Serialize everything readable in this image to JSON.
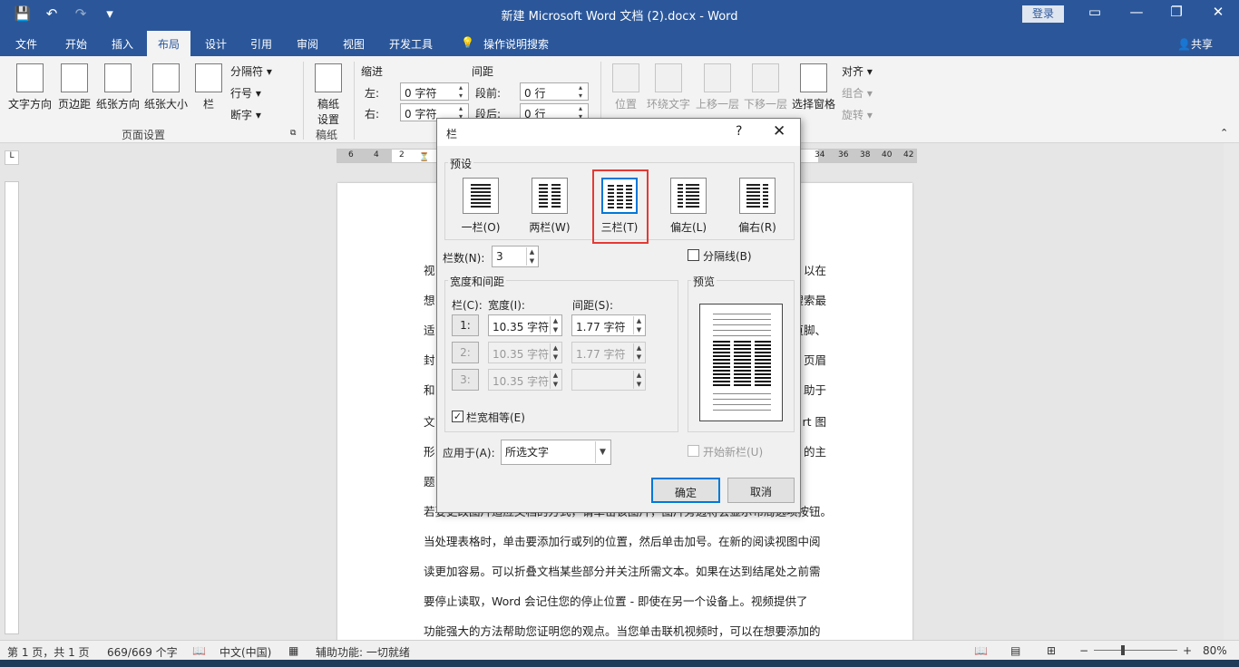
{
  "window": {
    "title": "新建 Microsoft Word 文档 (2).docx  -  Word",
    "login": "登录",
    "qat": [
      "💾",
      "↶",
      "↷",
      "▾"
    ],
    "controls": [
      "▭",
      "—",
      "❐",
      "✕"
    ]
  },
  "tabs": [
    "文件",
    "开始",
    "插入",
    "布局",
    "设计",
    "引用",
    "审阅",
    "视图",
    "开发工具",
    "操作说明搜索"
  ],
  "active_tab": "布局",
  "share": "共享",
  "ribbon": {
    "page_setup": {
      "label": "页面设置",
      "buttons": [
        "文字方向",
        "页边距",
        "纸张方向",
        "纸张大小",
        "栏"
      ],
      "small": [
        "分隔符 ▾",
        "行号 ▾",
        "断字 ▾"
      ]
    },
    "manuscript": {
      "label": "稿纸",
      "button": "稿纸\n设置"
    },
    "paragraph": {
      "indent_label": "缩进",
      "spacing_label": "间距",
      "left_label": "左:",
      "right_label": "右:",
      "before_label": "段前:",
      "after_label": "段后:",
      "left_value": "0 字符",
      "right_value": "0 字符",
      "before_value": "0 行",
      "after_value": "0 行"
    },
    "arrange": {
      "buttons": [
        "位置",
        "环绕文字",
        "上移一层",
        "下移一层",
        "选择窗格"
      ],
      "small": [
        "对齐 ▾",
        "组合 ▾",
        "旋转 ▾"
      ]
    }
  },
  "ruler": {
    "left_ticks": [
      "6",
      "4",
      "2"
    ],
    "right_ticks": [
      "34",
      "36",
      "38",
      "40",
      "42"
    ]
  },
  "document": {
    "left_chars": [
      "视",
      "想",
      "适",
      "封",
      "和",
      "文",
      "形",
      "题"
    ],
    "right_chars": [
      "以在",
      "搜索最",
      "页脚、",
      "页眉",
      "助于",
      "rt 图",
      "的主"
    ],
    "lines": [
      "若要更改图片适应文档的方式，请单击该图片，图片旁边将会显示布局选项按钮。",
      "当处理表格时，单击要添加行或列的位置，然后单击加号。在新的阅读视图中阅",
      "读更加容易。可以折叠文档某些部分并关注所需文本。如果在达到结尾处之前需",
      "要停止读取，Word 会记住您的停止位置 - 即使在另一个设备上。视频提供了",
      "功能强大的方法帮助您证明您的观点。当您单击联机视频时，可以在想要添加的"
    ]
  },
  "dialog": {
    "title": "栏",
    "help": "?",
    "close": "✕",
    "preset_label": "预设",
    "presets": [
      "一栏(O)",
      "两栏(W)",
      "三栏(T)",
      "偏左(L)",
      "偏右(R)"
    ],
    "selected_preset": "三栏(T)",
    "columns_label": "栏数(N):",
    "columns_value": "3",
    "separator_label": "分隔线(B)",
    "width_spacing_label": "宽度和间距",
    "col_header": "栏(C):",
    "width_header": "宽度(I):",
    "spacing_header": "间距(S):",
    "rows": [
      {
        "index": "1:",
        "width": "10.35 字符",
        "spacing": "1.77 字符"
      },
      {
        "index": "2:",
        "width": "10.35 字符",
        "spacing": "1.77 字符"
      },
      {
        "index": "3:",
        "width": "10.35 字符",
        "spacing": ""
      }
    ],
    "equal_width_label": "栏宽相等(E)",
    "equal_width_checked": "✓",
    "apply_label": "应用于(A):",
    "apply_value": "所选文字",
    "preview_label": "预览",
    "new_column_label": "开始新栏(U)",
    "ok": "确定",
    "cancel": "取消"
  },
  "statusbar": {
    "page": "第 1 页，共 1 页",
    "words": "669/669 个字",
    "language": "中文(中国)",
    "accessibility": "辅助功能: 一切就绪",
    "zoom": "80%"
  },
  "colors": {
    "brand": "#2b579a",
    "highlight": "#e53935",
    "default_button": "#0078d7"
  }
}
